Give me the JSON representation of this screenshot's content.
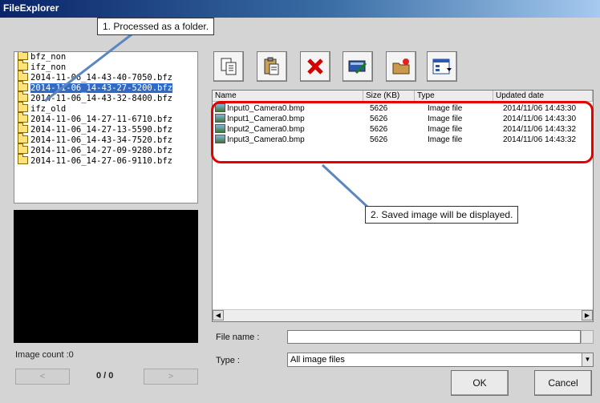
{
  "window": {
    "title": "FileExplorer"
  },
  "callouts": {
    "folder": "1. Processed as a folder.",
    "saved": "2. Saved image will be displayed."
  },
  "tree": {
    "items": [
      {
        "label": "bfz_non",
        "selected": false
      },
      {
        "label": "ifz_non",
        "selected": false
      },
      {
        "label": "2014-11-06_14-43-40-7050.bfz",
        "selected": false
      },
      {
        "label": "2014-11-06_14-43-27-5200.bfz",
        "selected": true
      },
      {
        "label": "2014-11-06_14-43-32-8400.bfz",
        "selected": false
      },
      {
        "label": "ifz_old",
        "selected": false
      },
      {
        "label": "2014-11-06_14-27-11-6710.bfz",
        "selected": false
      },
      {
        "label": "2014-11-06_14-27-13-5590.bfz",
        "selected": false
      },
      {
        "label": "2014-11-06_14-43-34-7520.bfz",
        "selected": false
      },
      {
        "label": "2014-11-06_14-27-09-9280.bfz",
        "selected": false
      },
      {
        "label": "2014-11-06_14-27-06-9110.bfz",
        "selected": false
      }
    ]
  },
  "preview": {
    "image_count_label": "Image count :0",
    "pager": "0 / 0",
    "prev_label": "<",
    "next_label": ">"
  },
  "toolbar": {
    "buttons": [
      {
        "icon": "copy-icon"
      },
      {
        "icon": "paste-icon"
      },
      {
        "icon": "delete-icon"
      },
      {
        "icon": "rename-icon"
      },
      {
        "icon": "new-folder-icon"
      },
      {
        "icon": "view-mode-icon"
      }
    ]
  },
  "file_list": {
    "columns": [
      "Name",
      "Size (KB)",
      "Type",
      "Updated date"
    ],
    "rows": [
      {
        "name": "Input0_Camera0.bmp",
        "size": "5626",
        "type": "Image file",
        "date": "2014/11/06 14:43:30"
      },
      {
        "name": "Input1_Camera0.bmp",
        "size": "5626",
        "type": "Image file",
        "date": "2014/11/06 14:43:30"
      },
      {
        "name": "Input2_Camera0.bmp",
        "size": "5626",
        "type": "Image file",
        "date": "2014/11/06 14:43:32"
      },
      {
        "name": "Input3_Camera0.bmp",
        "size": "5626",
        "type": "Image file",
        "date": "2014/11/06 14:43:32"
      }
    ]
  },
  "form": {
    "file_name_label": "File name :",
    "file_name_value": "",
    "type_label": "Type :",
    "type_value": "All image files"
  },
  "buttons": {
    "ok": "OK",
    "cancel": "Cancel"
  },
  "colors": {
    "highlight": "#e50000",
    "selection": "#316ac5",
    "callout_line": "#5b86c0"
  }
}
